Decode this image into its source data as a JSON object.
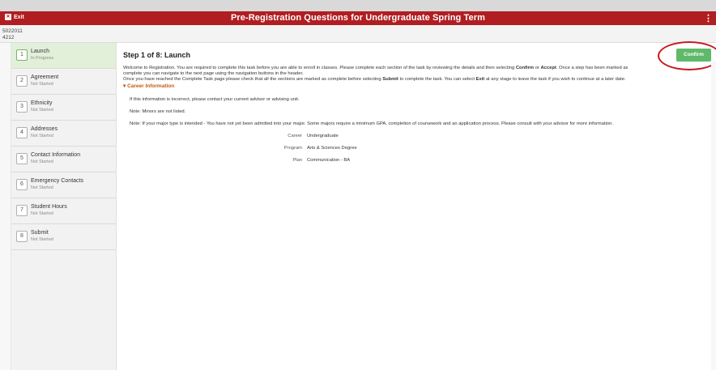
{
  "header": {
    "exit_label": "Exit",
    "title": "Pre-Registration Questions for Undergraduate Spring Term",
    "menu_glyph": "⋮"
  },
  "ids": {
    "line1": "5022011",
    "line2": "4212"
  },
  "steps": [
    {
      "num": "1",
      "title": "Launch",
      "status": "In Progress"
    },
    {
      "num": "2",
      "title": "Agreement",
      "status": "Not Started"
    },
    {
      "num": "3",
      "title": "Ethnicity",
      "status": "Not Started"
    },
    {
      "num": "4",
      "title": "Addresses",
      "status": "Not Started"
    },
    {
      "num": "5",
      "title": "Contact Information",
      "status": "Not Started"
    },
    {
      "num": "6",
      "title": "Emergency Contacts",
      "status": "Not Started"
    },
    {
      "num": "7",
      "title": "Student Hours",
      "status": "Not Started"
    },
    {
      "num": "8",
      "title": "Submit",
      "status": "Not Started"
    }
  ],
  "main": {
    "heading": "Step 1 of 8: Launch",
    "confirm_label": "Confirm",
    "welcome_line1_pre": "Welcome to Registration. You are required to complete this task before you are able to enroll in classes. Please complete each section of the task by reviewing the details and then selecting ",
    "welcome_confirm": "Confirm",
    "welcome_or": " or ",
    "welcome_accept": "Accept",
    "welcome_line1_post": ". Once a step has been marked as",
    "welcome_line2": "complete you can navigate to the next page using the navigation buttons in the header.",
    "welcome_line3_pre": "Once you have reached the Complete Task page please check that all the sections are marked as complete before selecting ",
    "welcome_submit": "Submit",
    "welcome_line3_mid": " to complete the task. You can select ",
    "welcome_exit": "Exit",
    "welcome_line3_post": " at any stage to leave the task if you wish to continue at a later date.",
    "section_title": "Career Information",
    "section_arrow": "▾",
    "note_incorrect": "If this information is incorrect, please contact your current advisor or advising unit.",
    "note_minors": "Note: Minors are not listed.",
    "note_major": "Note: If your major type is intended - You have not yet been admitted into your major.  Some majors require a minimum GPA, completion of coursework and an application process.  Please consult with your advisor for more information.",
    "fields": [
      {
        "label": "Career",
        "value": "Undergraduate"
      },
      {
        "label": "Program",
        "value": "Arts & Sciences Degree"
      },
      {
        "label": "Plan",
        "value": "Communication - BA"
      }
    ]
  }
}
